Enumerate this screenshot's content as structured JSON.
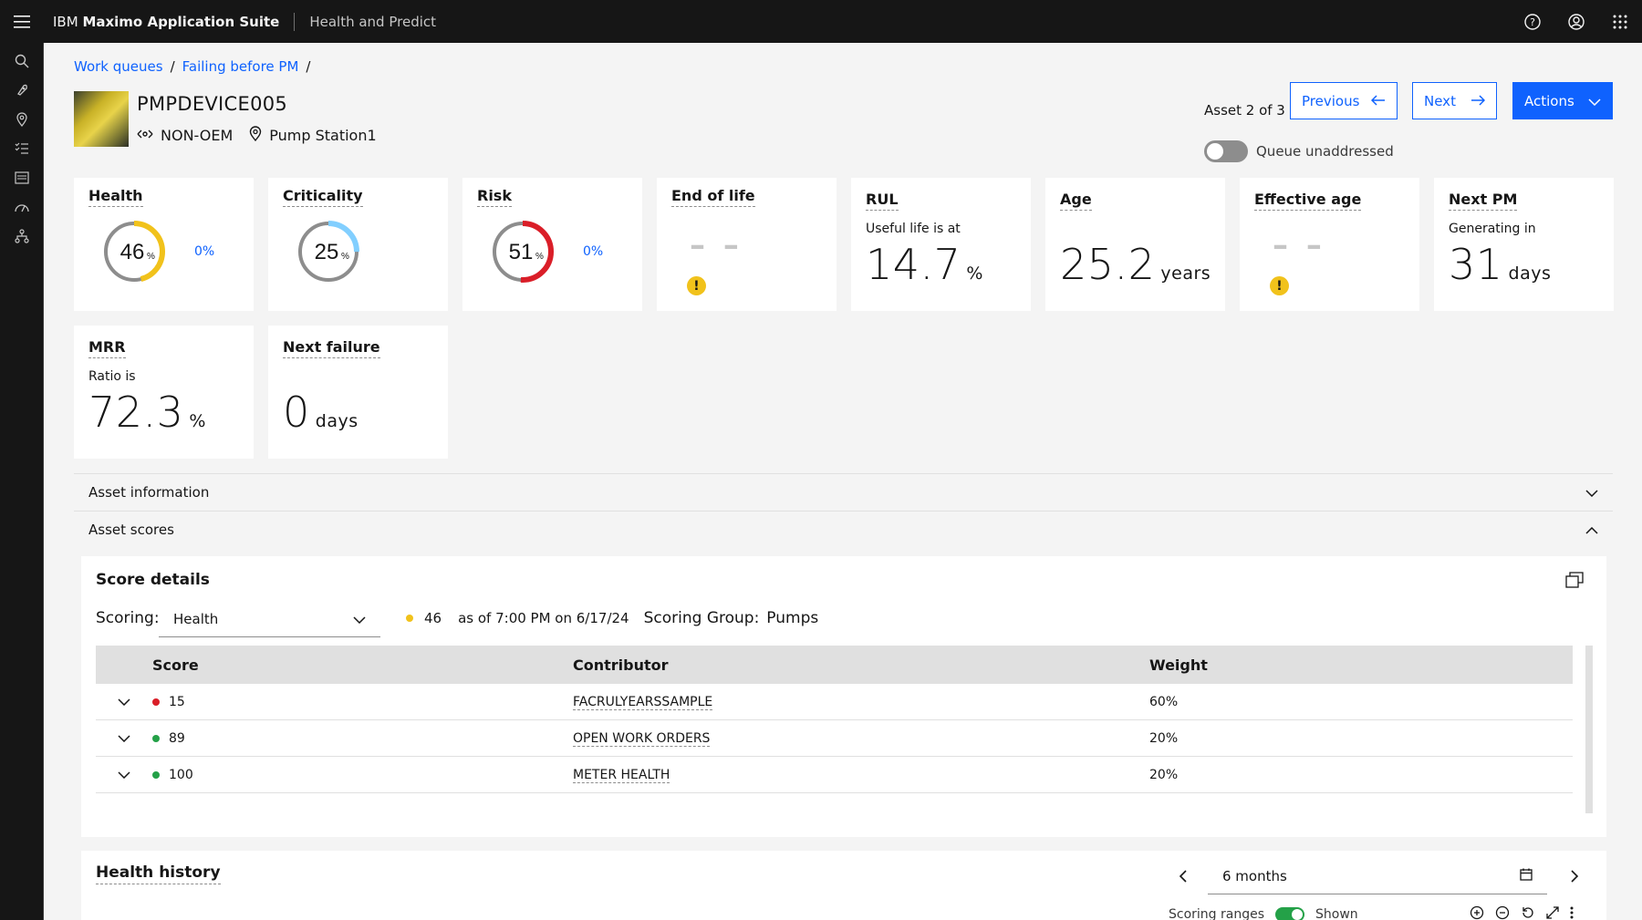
{
  "header": {
    "brand_prefix": "IBM",
    "brand_name": "Maximo Application Suite",
    "app_name": "Health and Predict"
  },
  "breadcrumb": {
    "items": [
      "Work queues",
      "Failing before PM"
    ]
  },
  "asset": {
    "id": "PMPDEVICE005",
    "type": "NON-OEM",
    "location": "Pump Station1",
    "position_label": "Asset 2 of 3",
    "queue_toggle_label": "Queue unaddressed",
    "queue_toggle_on": false
  },
  "buttons": {
    "previous": "Previous",
    "next": "Next",
    "actions": "Actions"
  },
  "cards": {
    "health": {
      "title": "Health",
      "value": "46",
      "unit": "%",
      "fraction": 0.46,
      "color": "#f1c21b",
      "side": "0%"
    },
    "criticality": {
      "title": "Criticality",
      "value": "25",
      "unit": "%",
      "fraction": 0.25,
      "color": "#82cfff"
    },
    "risk": {
      "title": "Risk",
      "value": "51",
      "unit": "%",
      "fraction": 0.51,
      "color": "#da1e28",
      "side": "0%"
    },
    "end_of_life": {
      "title": "End of life",
      "value": "– –"
    },
    "rul": {
      "title": "RUL",
      "sub": "Useful life is at",
      "value": "14.7",
      "unit": "%"
    },
    "age": {
      "title": "Age",
      "value": "25.2",
      "unit": "years"
    },
    "effective_age": {
      "title": "Effective age",
      "value": "– –"
    },
    "next_pm": {
      "title": "Next PM",
      "sub": "Generating in",
      "value": "31",
      "unit": "days"
    },
    "mrr": {
      "title": "MRR",
      "sub": "Ratio is",
      "value": "72.3",
      "unit": "%"
    },
    "next_failure": {
      "title": "Next failure",
      "value": "0",
      "unit": "days"
    }
  },
  "accordions": {
    "asset_information": "Asset information",
    "asset_scores": "Asset scores"
  },
  "score_details": {
    "title": "Score details",
    "scoring_label": "Scoring:",
    "scoring_value": "Health",
    "score": "46",
    "score_color": "#f1c21b",
    "as_of": "as of 7:00 PM on 6/17/24",
    "group_label": "Scoring Group:",
    "group_value": "Pumps",
    "columns": [
      "Score",
      "Contributor",
      "Weight"
    ],
    "rows": [
      {
        "score": "15",
        "color": "#da1e28",
        "contributor": "FACRULYEARSSAMPLE",
        "weight": "60%"
      },
      {
        "score": "89",
        "color": "#24a148",
        "contributor": "OPEN WORK ORDERS",
        "weight": "20%"
      },
      {
        "score": "100",
        "color": "#24a148",
        "contributor": "METER HEALTH",
        "weight": "20%"
      }
    ]
  },
  "health_history": {
    "title": "Health history",
    "range": "6 months",
    "scoring_ranges_label": "Scoring ranges",
    "shown_label": "Shown"
  }
}
